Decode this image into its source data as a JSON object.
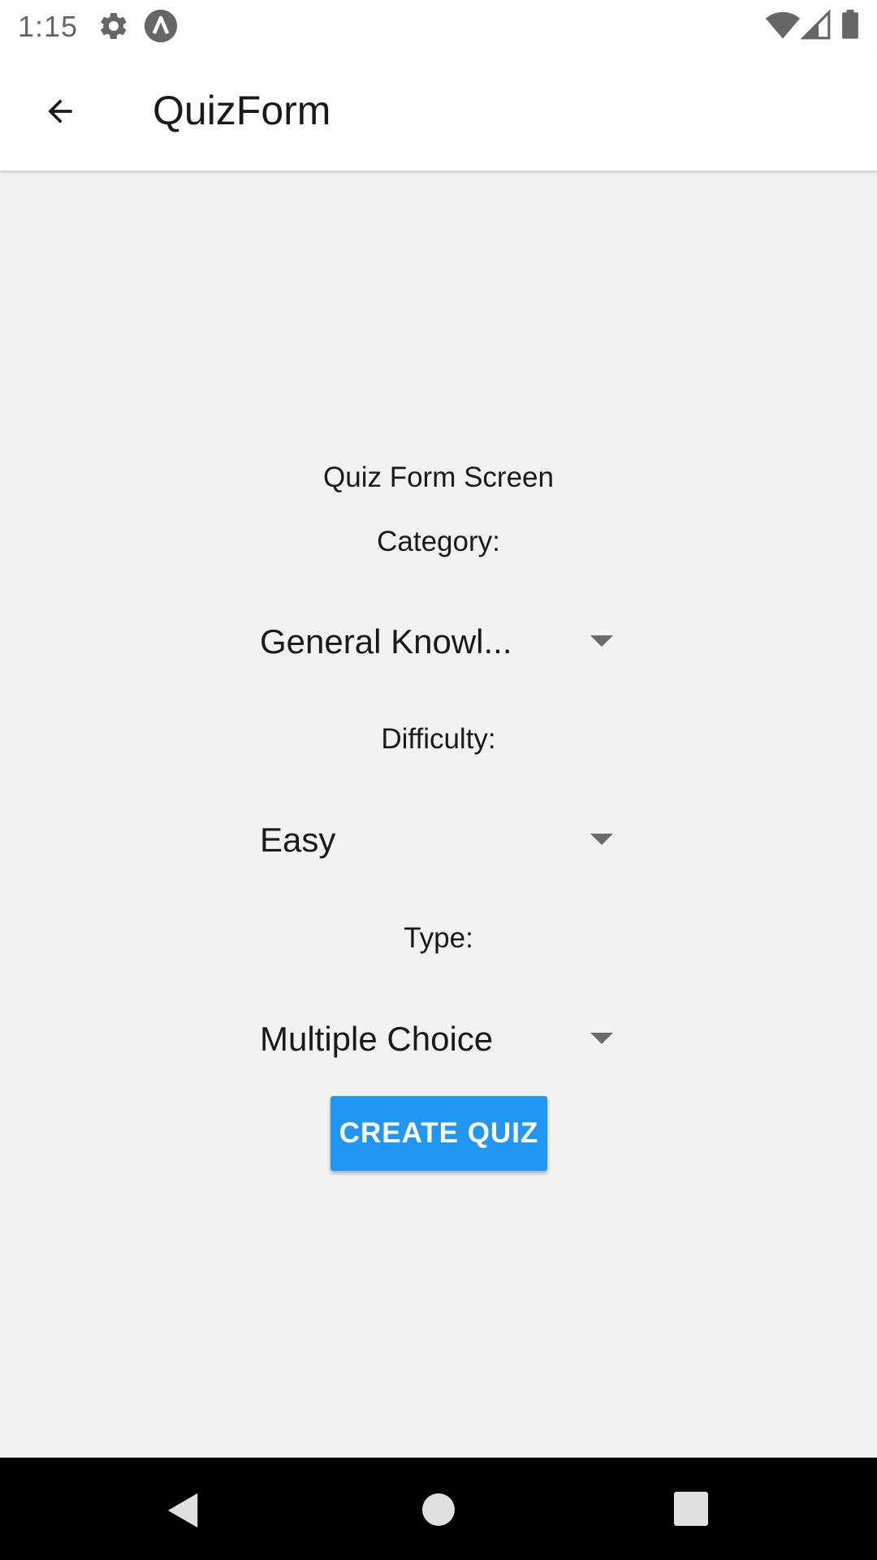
{
  "status_bar": {
    "time": "1:15",
    "icons": [
      "settings-icon",
      "app-badge-icon",
      "wifi-icon",
      "signal-icon",
      "battery-icon"
    ]
  },
  "app_bar": {
    "title": "QuizForm",
    "back_icon": "arrow-back-icon"
  },
  "form": {
    "screen_title": "Quiz Form Screen",
    "category_label": "Category:",
    "category_value": "General Knowl...",
    "difficulty_label": "Difficulty:",
    "difficulty_value": "Easy",
    "type_label": "Type:",
    "type_value": "Multiple Choice",
    "create_button_label": "CREATE QUIZ"
  },
  "nav_bar": {
    "icons": [
      "nav-back-icon",
      "nav-home-icon",
      "nav-recents-icon"
    ]
  },
  "colors": {
    "accent": "#2196f3",
    "background": "#f2f2f2",
    "app_bar": "#ffffff",
    "nav_bar": "#000000"
  }
}
